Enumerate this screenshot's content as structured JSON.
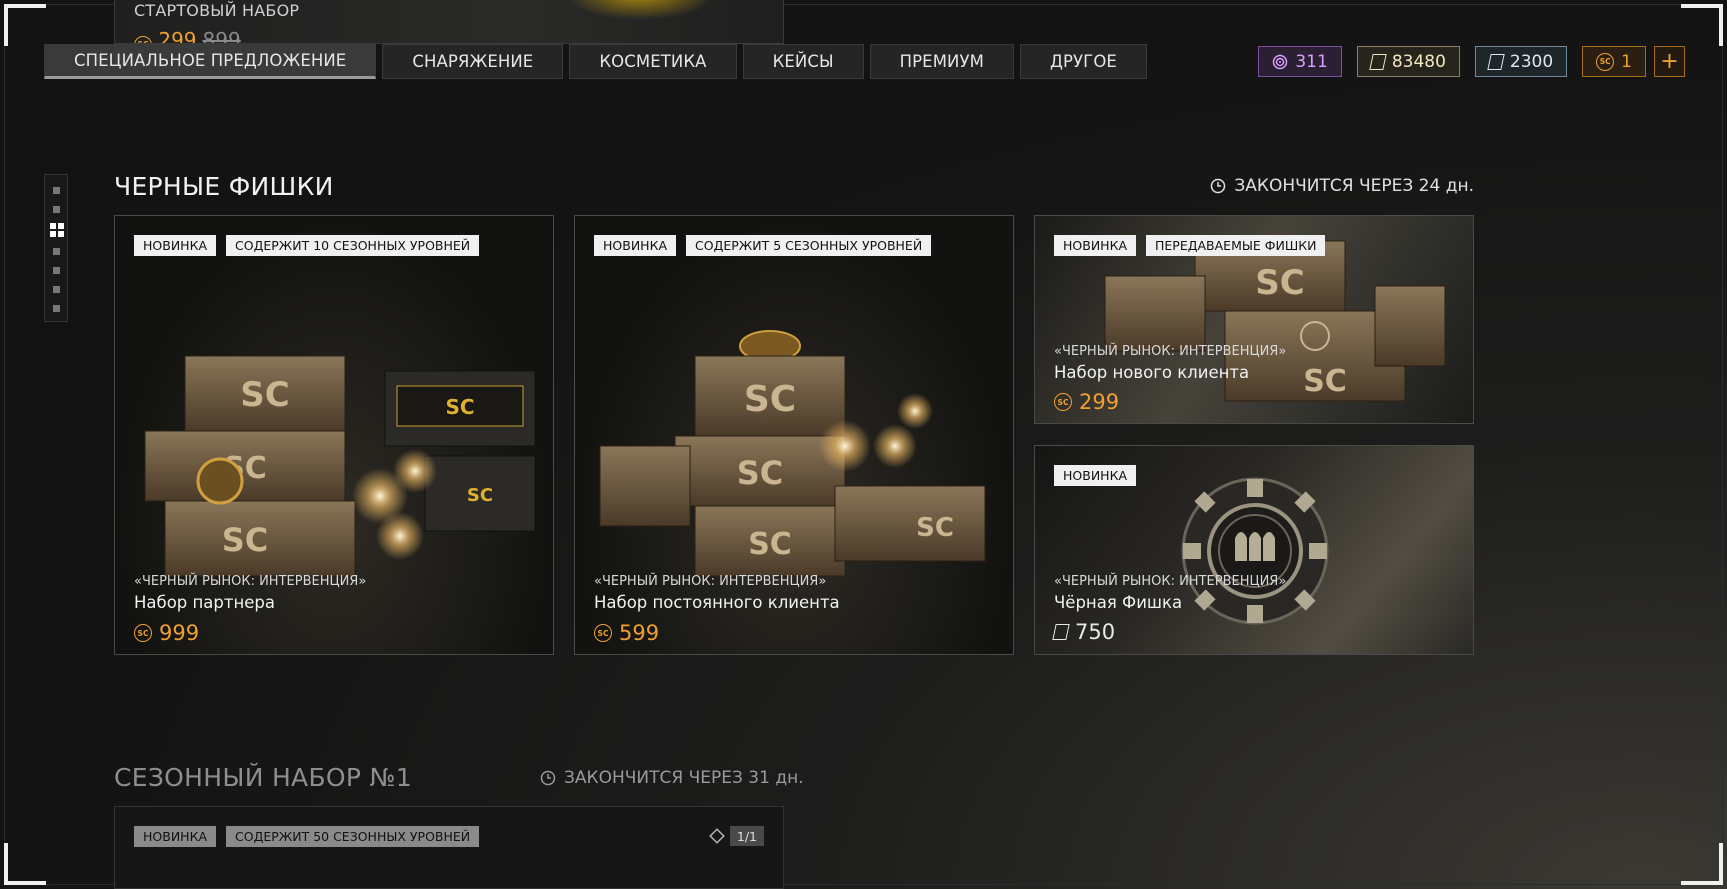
{
  "peek": {
    "title": "СТАРТОВЫЙ НАБОР",
    "price": "299",
    "old_price": "899"
  },
  "tabs": [
    {
      "label": "СПЕЦИАЛЬНОЕ ПРЕДЛОЖЕНИЕ",
      "active": true
    },
    {
      "label": "СНАРЯЖЕНИЕ"
    },
    {
      "label": "КОСМЕТИКА"
    },
    {
      "label": "КЕЙСЫ"
    },
    {
      "label": "ПРЕМИУМ"
    },
    {
      "label": "ДРУГОЕ"
    }
  ],
  "currencies": {
    "purple": "311",
    "gold": "83480",
    "silver": "2300",
    "orange": "1",
    "plus": "+"
  },
  "section1": {
    "title": "ЧЕРНЫЕ ФИШКИ",
    "timer": "ЗАКОНЧИТСЯ ЧЕРЕЗ 24 дн."
  },
  "cards": [
    {
      "tags": [
        "НОВИНКА",
        "СОДЕРЖИТ 10 СЕЗОННЫХ УРОВНЕЙ"
      ],
      "subtitle": "«ЧЕРНЫЙ РЫНОК: ИНТЕРВЕНЦИЯ»",
      "name": "Набор партнера",
      "price": "999"
    },
    {
      "tags": [
        "НОВИНКА",
        "СОДЕРЖИТ 5 СЕЗОННЫХ УРОВНЕЙ"
      ],
      "subtitle": "«ЧЕРНЫЙ РЫНОК: ИНТЕРВЕНЦИЯ»",
      "name": "Набор постоянного клиента",
      "price": "599"
    },
    {
      "tags": [
        "НОВИНКА",
        "ПЕРЕДАВАЕМЫЕ ФИШКИ"
      ],
      "subtitle": "«ЧЕРНЫЙ РЫНОК: ИНТЕРВЕНЦИЯ»",
      "name": "Набор нового клиента",
      "price": "299"
    },
    {
      "tags": [
        "НОВИНКА"
      ],
      "subtitle": "«ЧЕРНЫЙ РЫНОК: ИНТЕРВЕНЦИЯ»",
      "name": "Чёрная Фишка",
      "price": "750"
    }
  ],
  "section2": {
    "title": "СЕЗОННЫЙ НАБОР №1",
    "timer": "ЗАКОНЧИТСЯ ЧЕРЕЗ 31 дн.",
    "tags": [
      "НОВИНКА",
      "СОДЕРЖИТ 50 СЕЗОННЫХ УРОВНЕЙ"
    ],
    "count": "1/1"
  },
  "colors": {
    "accent_orange": "#f0a030",
    "purple_currency": "#d9a0ff",
    "background": "#131313"
  },
  "icons": {
    "crate": "SC",
    "chip_emblem": "three-bullets"
  }
}
